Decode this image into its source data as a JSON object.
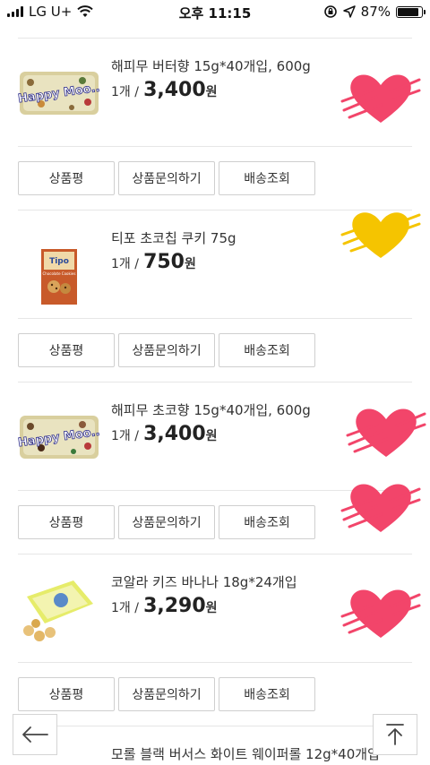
{
  "status_bar": {
    "carrier": "LG U+",
    "time": "오후 11:15",
    "battery": "87%"
  },
  "products": [
    {
      "name": "해피무 버터향 15g*40개입, 600g",
      "qty": "1개 /",
      "price": "3,400",
      "unit": "원",
      "wishlist": true,
      "heart_color": "#f2456a"
    },
    {
      "name": "티포 초코칩 쿠키 75g",
      "qty": "1개 /",
      "price": "750",
      "unit": "원",
      "wishlist": true,
      "heart_color": "#f5c400"
    },
    {
      "name": "해피무 초코향 15g*40개입, 600g",
      "qty": "1개 /",
      "price": "3,400",
      "unit": "원",
      "wishlist": true,
      "heart_color": "#f2456a"
    },
    {
      "name": "코알라 키즈 바나나 18g*24개입",
      "qty": "1개 /",
      "price": "3,290",
      "unit": "원",
      "wishlist": true,
      "heart_color": "#f2456a"
    },
    {
      "name": "모롤 블랙 버서스 화이트 웨이퍼롤 12g*40개입",
      "qty": "",
      "price": "",
      "unit": "",
      "wishlist": false
    }
  ],
  "actions": {
    "review": "상품평",
    "inquiry": "상품문의하기",
    "delivery": "배송조회"
  },
  "packaging_text": {
    "happy_moo": "Happy Moo..",
    "tipo": "Tipo",
    "tipo_sub": "Chocolate Cookies"
  },
  "icons": {
    "back": "left-arrow-icon",
    "top": "scroll-to-top-icon"
  }
}
